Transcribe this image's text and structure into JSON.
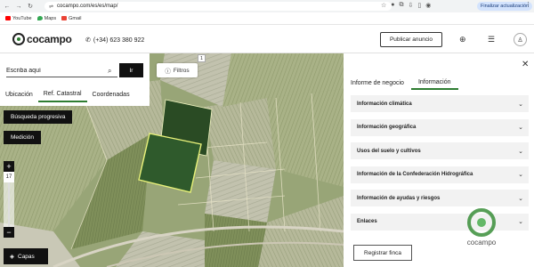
{
  "browser": {
    "url": "cocampo.com/es/es/map/",
    "update_label": "Finalizar actualización",
    "bookmarks": [
      {
        "label": "YouTube",
        "color": "#ff0000"
      },
      {
        "label": "Maps",
        "color": "#34a853"
      },
      {
        "label": "Gmail",
        "color": "#ea4335"
      }
    ]
  },
  "header": {
    "logo_text": "cocampo",
    "phone": "(+34) 623 380 922",
    "publish_label": "Publicar anuncio"
  },
  "search": {
    "placeholder": "Escriba aquí",
    "go_label": "Ir",
    "tabs": [
      "Ubicación",
      "Ref. Catastral",
      "Coordenadas"
    ],
    "active_tab": "Ref. Catastral"
  },
  "map": {
    "filters_label": "Filtros",
    "filters_count": "1",
    "progressive_search_label": "Búsqueda progresiva",
    "measure_label": "Medición",
    "zoom_level": "17",
    "layers_label": "Capas"
  },
  "panel": {
    "tabs": [
      "Informe de negocio",
      "Información"
    ],
    "active_tab": "Información",
    "sections": [
      "Información climática",
      "Información geográfica",
      "Usos del suelo y cultivos",
      "Información de la Confederación Hidrográfica",
      "Información de ayudas y riesgos",
      "Enlaces"
    ],
    "register_label": "Registrar finca",
    "watermark_text": "cocampo"
  },
  "colors": {
    "accent": "#2e7d32",
    "selected_parcel": "#2f5a2c",
    "parcel_border": "#e9f27a"
  }
}
